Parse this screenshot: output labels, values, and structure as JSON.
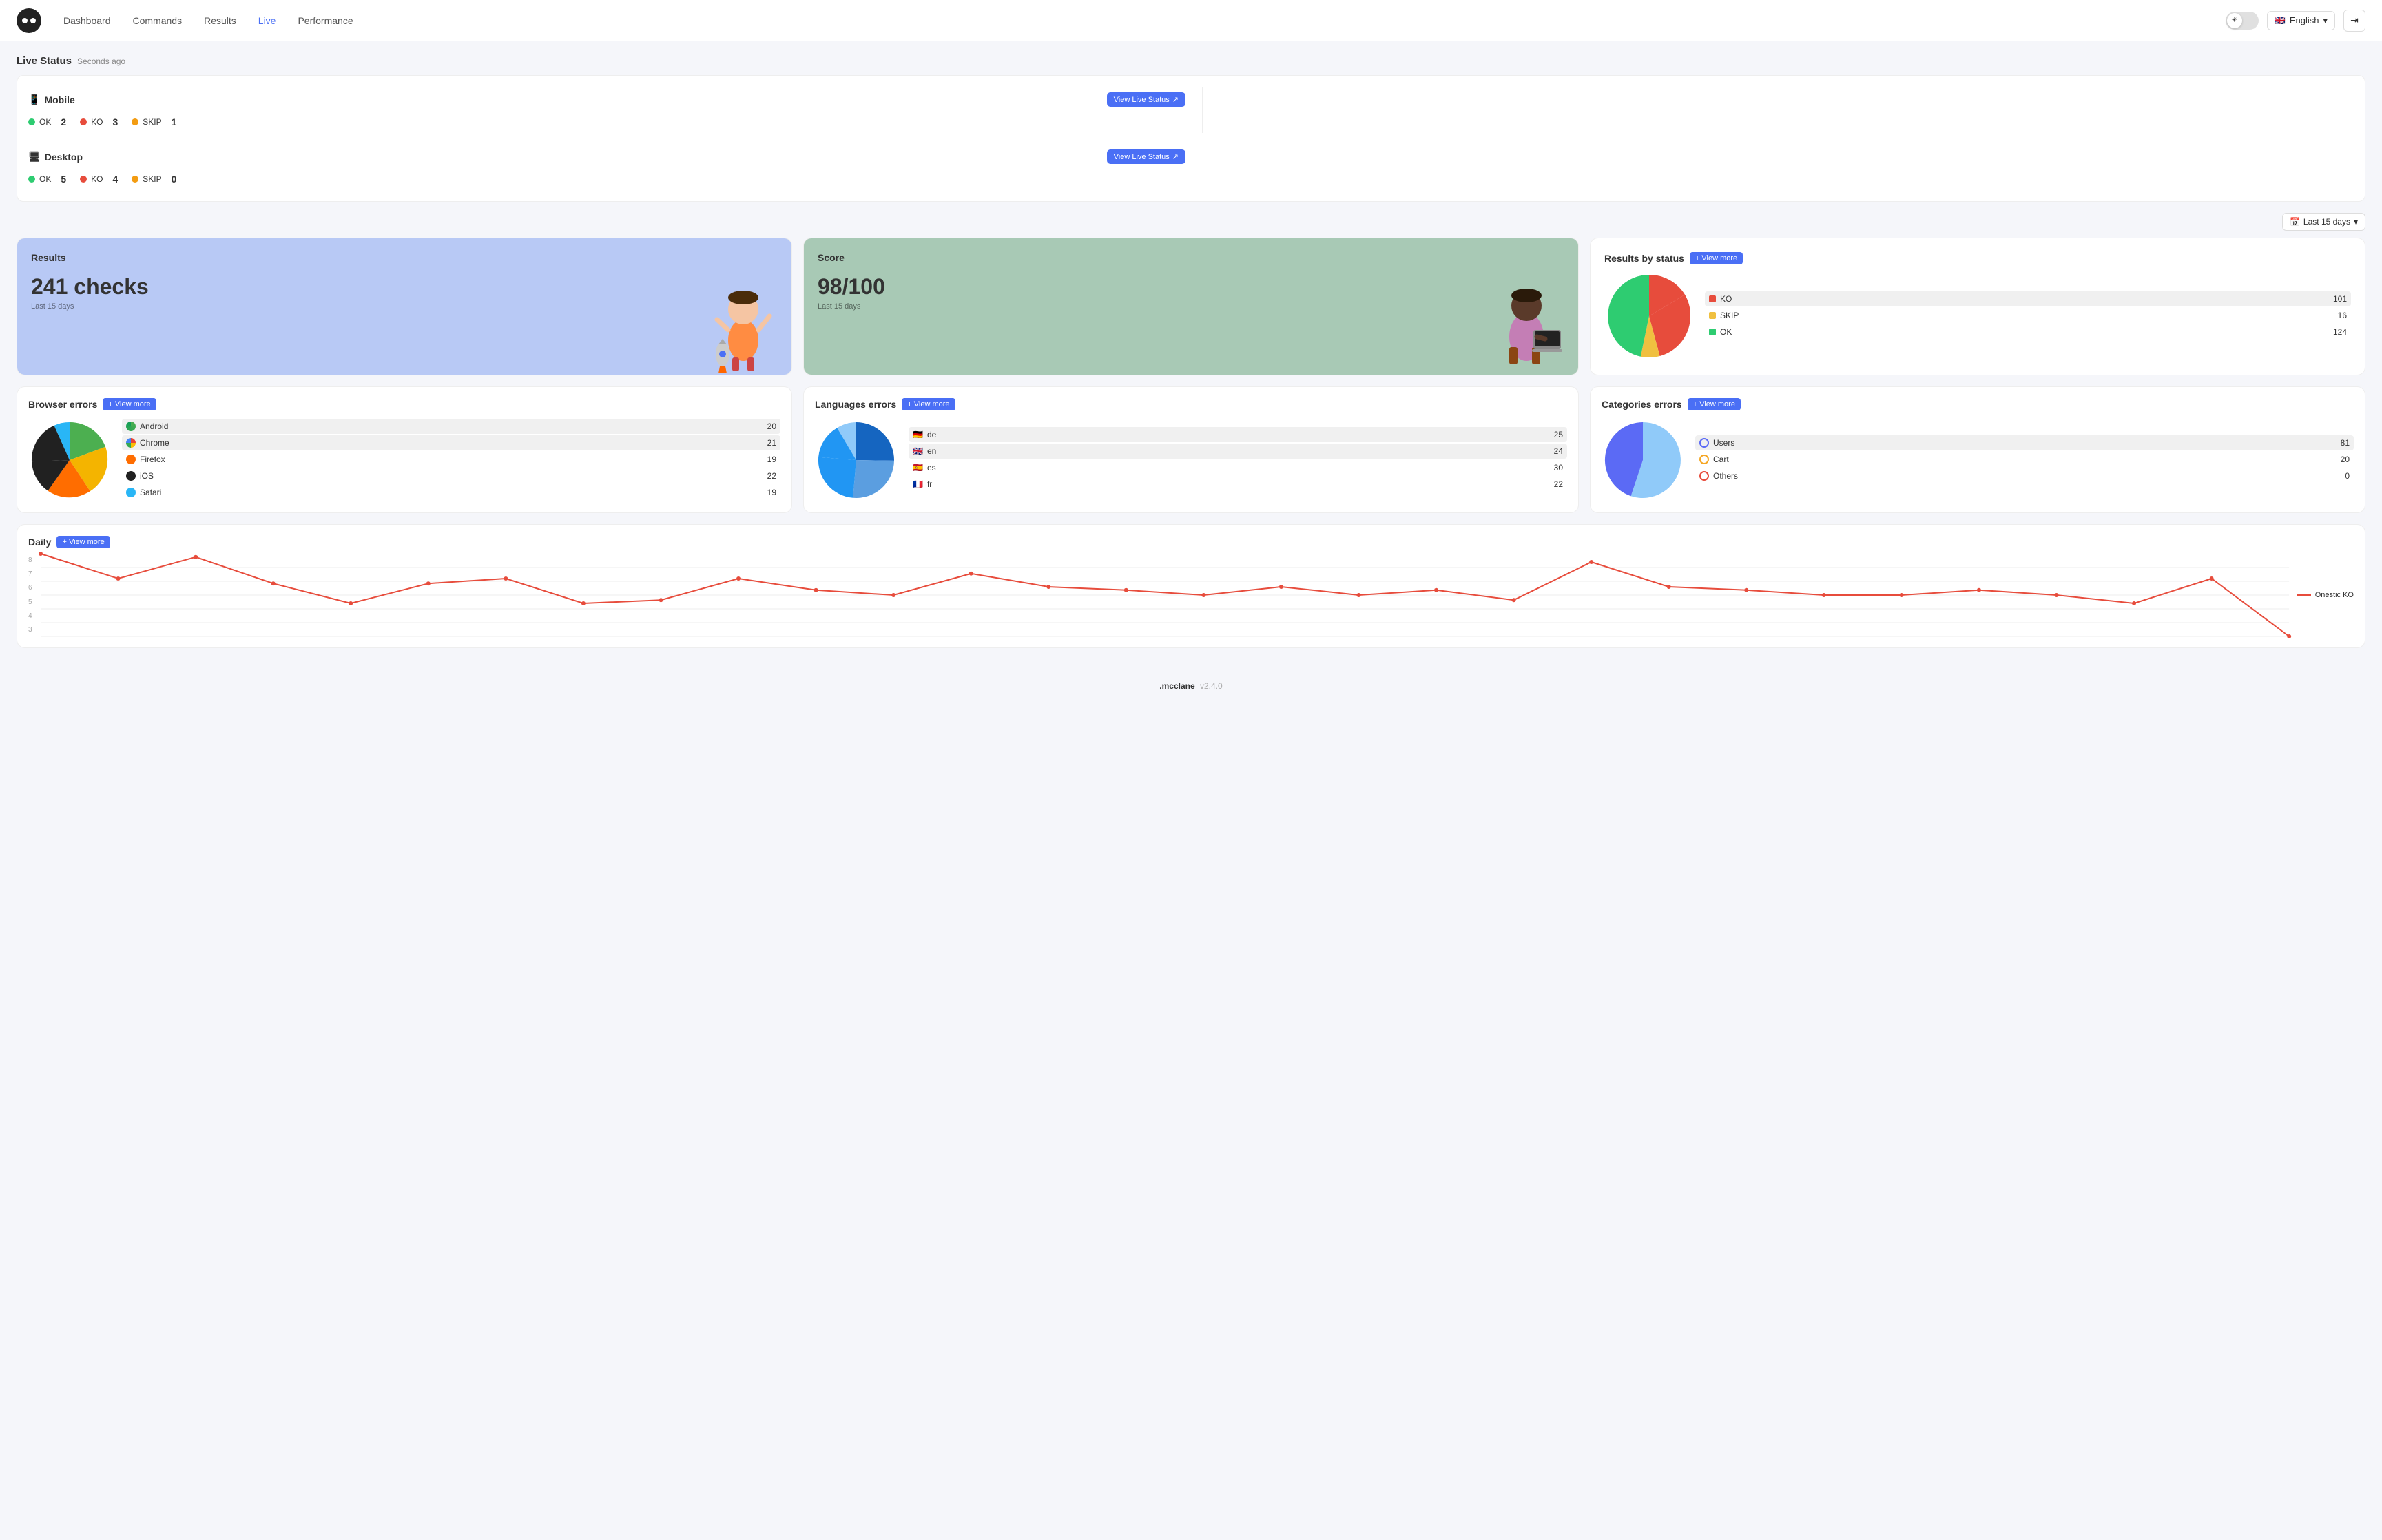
{
  "header": {
    "logo_alt": "app logo",
    "nav": [
      {
        "label": "Dashboard",
        "active": false
      },
      {
        "label": "Commands",
        "active": false
      },
      {
        "label": "Results",
        "active": false
      },
      {
        "label": "Live",
        "active": true
      },
      {
        "label": "Performance",
        "active": false
      }
    ],
    "lang": "English",
    "lang_flag": "🇬🇧"
  },
  "live_status": {
    "title": "Live Status",
    "time": "Seconds ago",
    "mobile": {
      "label": "Mobile",
      "ok_count": 2,
      "ko_count": 3,
      "skip_count": 1,
      "btn_label": "View Live Status"
    },
    "desktop": {
      "label": "Desktop",
      "ok_count": 5,
      "ko_count": 4,
      "skip_count": 0,
      "btn_label": "View Live Status"
    }
  },
  "filter": {
    "label": "Last 15 days"
  },
  "results_card": {
    "title": "Results",
    "value": "241 checks",
    "subtitle": "Last 15 days"
  },
  "score_card": {
    "title": "Score",
    "value": "98/100",
    "subtitle": "Last 15 days"
  },
  "status_card": {
    "title": "Results by status",
    "btn_label": "+ View more",
    "items": [
      {
        "label": "KO",
        "value": 101,
        "color": "#e74c3c"
      },
      {
        "label": "SKIP",
        "value": 16,
        "color": "#f0c040"
      },
      {
        "label": "OK",
        "value": 124,
        "color": "#2ecc71"
      }
    ]
  },
  "browser_errors": {
    "title": "Browser errors",
    "btn_label": "+ View more",
    "items": [
      {
        "label": "Android",
        "value": 20,
        "color": "#4CAF50"
      },
      {
        "label": "Chrome",
        "value": 21,
        "color": "#F4B400"
      },
      {
        "label": "Firefox",
        "value": 19,
        "color": "#FF6D00"
      },
      {
        "label": "iOS",
        "value": 22,
        "color": "#212121"
      },
      {
        "label": "Safari",
        "value": 19,
        "color": "#29B6F6"
      }
    ]
  },
  "lang_errors": {
    "title": "Languages errors",
    "btn_label": "+ View more",
    "items": [
      {
        "label": "de",
        "value": 25,
        "flag": "🇩🇪"
      },
      {
        "label": "en",
        "value": 24,
        "flag": "🇬🇧"
      },
      {
        "label": "es",
        "value": 30,
        "flag": "🇪🇸"
      },
      {
        "label": "fr",
        "value": 22,
        "flag": "🇫🇷"
      }
    ]
  },
  "categories_errors": {
    "title": "Categories errors",
    "btn_label": "+ View more",
    "items": [
      {
        "label": "Users",
        "value": 81,
        "color": "#5b6af5"
      },
      {
        "label": "Cart",
        "value": 20,
        "color": "#f5a623"
      },
      {
        "label": "Others",
        "value": 0,
        "color": "#e74c3c"
      }
    ]
  },
  "daily": {
    "title": "Daily",
    "btn_label": "+ View more",
    "legend": "Onestic KO",
    "y_labels": [
      "3",
      "4",
      "5",
      "6",
      "7",
      "8"
    ],
    "points": [
      8,
      6.5,
      7.8,
      6.2,
      5.0,
      6.2,
      6.5,
      5.0,
      5.2,
      6.5,
      5.8,
      5.5,
      6.8,
      6.0,
      5.8,
      5.5,
      6.0,
      5.5,
      5.8,
      5.2,
      7.5,
      6.0,
      5.8,
      5.5,
      5.5,
      5.8,
      5.5,
      5.0,
      6.5,
      3.0
    ]
  },
  "footer": {
    "brand": ".mcclane",
    "version": "v2.4.0"
  }
}
